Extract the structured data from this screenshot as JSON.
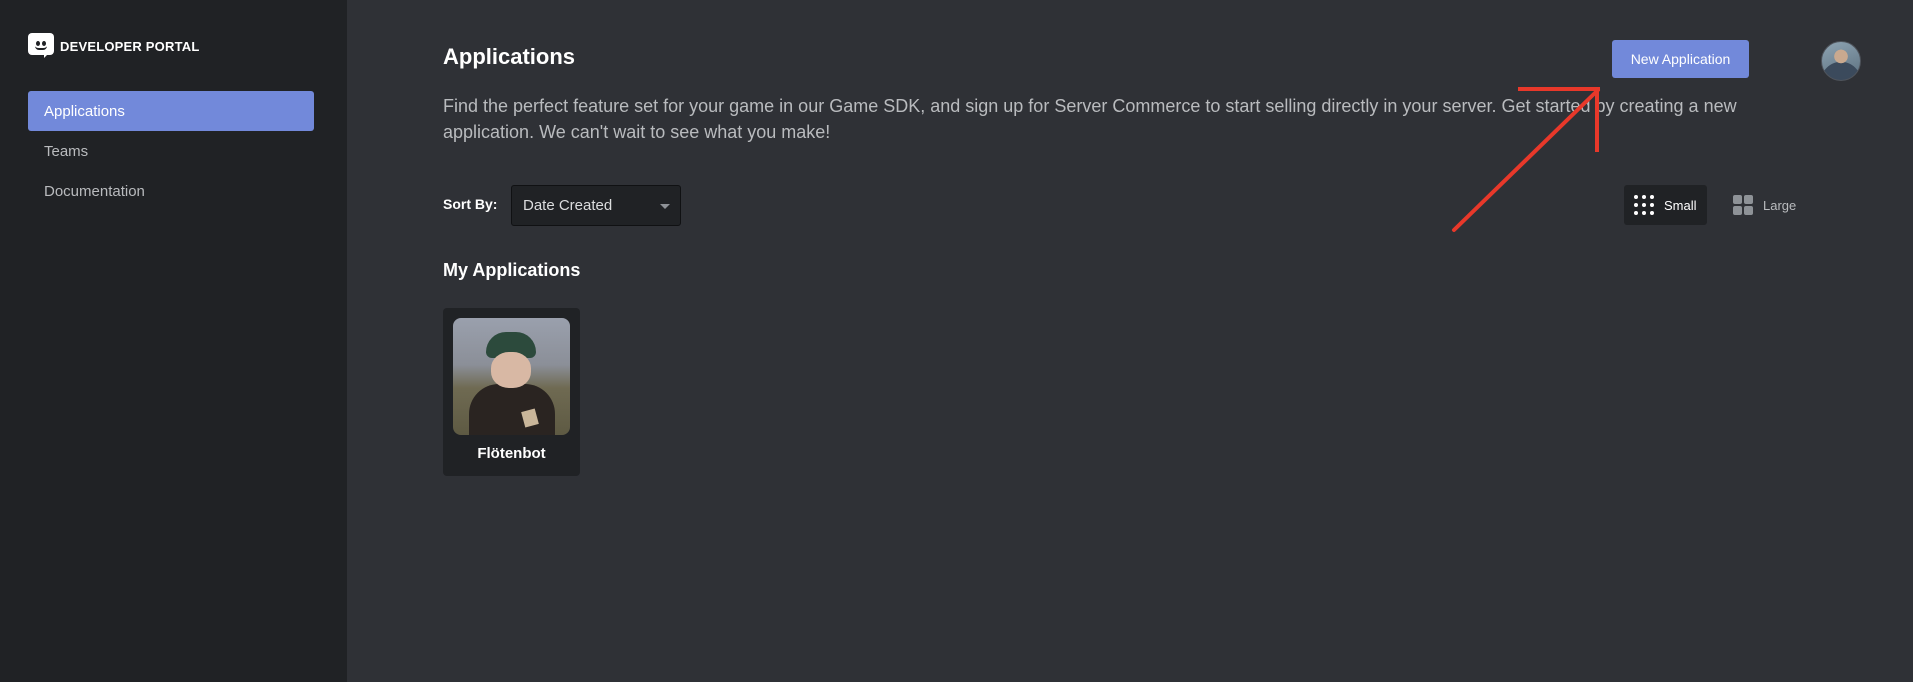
{
  "sidebar": {
    "brand": "DEVELOPER PORTAL",
    "items": [
      {
        "label": "Applications",
        "active": true
      },
      {
        "label": "Teams",
        "active": false
      },
      {
        "label": "Documentation",
        "active": false
      }
    ]
  },
  "header": {
    "title": "Applications",
    "new_app_label": "New Application",
    "intro": "Find the perfect feature set for your game in our Game SDK, and sign up for Server Commerce to start selling directly in your server. Get started by creating a new application. We can't wait to see what you make!"
  },
  "sort": {
    "label": "Sort By:",
    "selected": "Date Created"
  },
  "view": {
    "small_label": "Small",
    "large_label": "Large",
    "selected": "Small"
  },
  "apps_section": {
    "title": "My Applications",
    "apps": [
      {
        "name": "Flötenbot"
      }
    ]
  },
  "colors": {
    "accent": "#7289da",
    "sidebar_bg": "#202225",
    "main_bg": "#2f3136",
    "annotation": "#e8382a"
  }
}
